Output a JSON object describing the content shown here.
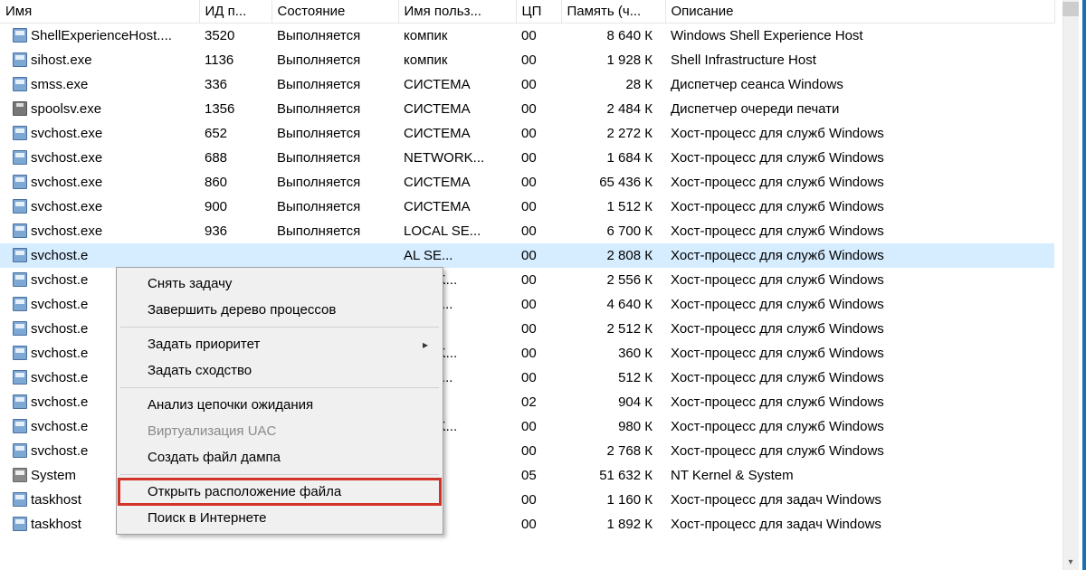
{
  "columns": {
    "name": "Имя",
    "pid": "ИД п...",
    "state": "Состояние",
    "user": "Имя польз...",
    "cpu": "ЦП",
    "mem": "Память (ч...",
    "desc": "Описание"
  },
  "rows": [
    {
      "icon": "app",
      "name": "ShellExperienceHost....",
      "pid": "3520",
      "state": "Выполняется",
      "user": "компик",
      "cpu": "00",
      "mem": "8 640 К",
      "desc": "Windows Shell Experience Host"
    },
    {
      "icon": "app",
      "name": "sihost.exe",
      "pid": "1136",
      "state": "Выполняется",
      "user": "компик",
      "cpu": "00",
      "mem": "1 928 К",
      "desc": "Shell Infrastructure Host"
    },
    {
      "icon": "app",
      "name": "smss.exe",
      "pid": "336",
      "state": "Выполняется",
      "user": "СИСТЕМА",
      "cpu": "00",
      "mem": "28 К",
      "desc": "Диспетчер сеанса  Windows"
    },
    {
      "icon": "printer",
      "name": "spoolsv.exe",
      "pid": "1356",
      "state": "Выполняется",
      "user": "СИСТЕМА",
      "cpu": "00",
      "mem": "2 484 К",
      "desc": "Диспетчер очереди печати"
    },
    {
      "icon": "app",
      "name": "svchost.exe",
      "pid": "652",
      "state": "Выполняется",
      "user": "СИСТЕМА",
      "cpu": "00",
      "mem": "2 272 К",
      "desc": "Хост-процесс для служб Windows"
    },
    {
      "icon": "app",
      "name": "svchost.exe",
      "pid": "688",
      "state": "Выполняется",
      "user": "NETWORK...",
      "cpu": "00",
      "mem": "1 684 К",
      "desc": "Хост-процесс для служб Windows"
    },
    {
      "icon": "app",
      "name": "svchost.exe",
      "pid": "860",
      "state": "Выполняется",
      "user": "СИСТЕМА",
      "cpu": "00",
      "mem": "65 436 К",
      "desc": "Хост-процесс для служб Windows"
    },
    {
      "icon": "app",
      "name": "svchost.exe",
      "pid": "900",
      "state": "Выполняется",
      "user": "СИСТЕМА",
      "cpu": "00",
      "mem": "1 512 К",
      "desc": "Хост-процесс для служб Windows"
    },
    {
      "icon": "app",
      "name": "svchost.exe",
      "pid": "936",
      "state": "Выполняется",
      "user": "LOCAL SE...",
      "cpu": "00",
      "mem": "6 700 К",
      "desc": "Хост-процесс для служб Windows"
    },
    {
      "icon": "app",
      "name": "svchost.e",
      "pid": "",
      "state": "",
      "user": "AL SE...",
      "cpu": "00",
      "mem": "2 808 К",
      "desc": "Хост-процесс для служб Windows",
      "selected": true
    },
    {
      "icon": "app",
      "name": "svchost.e",
      "pid": "",
      "state": "",
      "user": "WORK...",
      "cpu": "00",
      "mem": "2 556 К",
      "desc": "Хост-процесс для служб Windows"
    },
    {
      "icon": "app",
      "name": "svchost.e",
      "pid": "",
      "state": "",
      "user": "AL SE...",
      "cpu": "00",
      "mem": "4 640 К",
      "desc": "Хост-процесс для служб Windows"
    },
    {
      "icon": "app",
      "name": "svchost.e",
      "pid": "",
      "state": "",
      "user": "ТЕМА",
      "cpu": "00",
      "mem": "2 512 К",
      "desc": "Хост-процесс для служб Windows"
    },
    {
      "icon": "app",
      "name": "svchost.e",
      "pid": "",
      "state": "",
      "user": "WORK...",
      "cpu": "00",
      "mem": "360 К",
      "desc": "Хост-процесс для служб Windows"
    },
    {
      "icon": "app",
      "name": "svchost.e",
      "pid": "",
      "state": "",
      "user": "AL SE...",
      "cpu": "00",
      "mem": "512 К",
      "desc": "Хост-процесс для служб Windows"
    },
    {
      "icon": "app",
      "name": "svchost.e",
      "pid": "",
      "state": "",
      "user": "ТЕМА",
      "cpu": "02",
      "mem": "904 К",
      "desc": "Хост-процесс для служб Windows"
    },
    {
      "icon": "app",
      "name": "svchost.e",
      "pid": "",
      "state": "",
      "user": "WORK...",
      "cpu": "00",
      "mem": "980 К",
      "desc": "Хост-процесс для служб Windows"
    },
    {
      "icon": "app",
      "name": "svchost.e",
      "pid": "",
      "state": "",
      "user": "ик",
      "cpu": "00",
      "mem": "2 768 К",
      "desc": "Хост-процесс для служб Windows"
    },
    {
      "icon": "sys",
      "name": "System",
      "pid": "",
      "state": "",
      "user": "ТЕМА",
      "cpu": "05",
      "mem": "51 632 К",
      "desc": "NT Kernel & System"
    },
    {
      "icon": "app",
      "name": "taskhost",
      "pid": "",
      "state": "",
      "user": "ик",
      "cpu": "00",
      "mem": "1 160 К",
      "desc": "Хост-процесс для задач Windows"
    },
    {
      "icon": "app",
      "name": "taskhost",
      "pid": "",
      "state": "",
      "user": "ик",
      "cpu": "00",
      "mem": "1 892 К",
      "desc": "Хост-процесс для задач Windows"
    }
  ],
  "menu": {
    "end_task": "Снять задачу",
    "end_tree": "Завершить дерево процессов",
    "set_priority": "Задать приоритет",
    "set_affinity": "Задать сходство",
    "analyze_wait": "Анализ цепочки ожидания",
    "uac_virt": "Виртуализация UAC",
    "create_dump": "Создать файл дампа",
    "open_location": "Открыть расположение файла",
    "search_online": "Поиск в Интернете"
  }
}
